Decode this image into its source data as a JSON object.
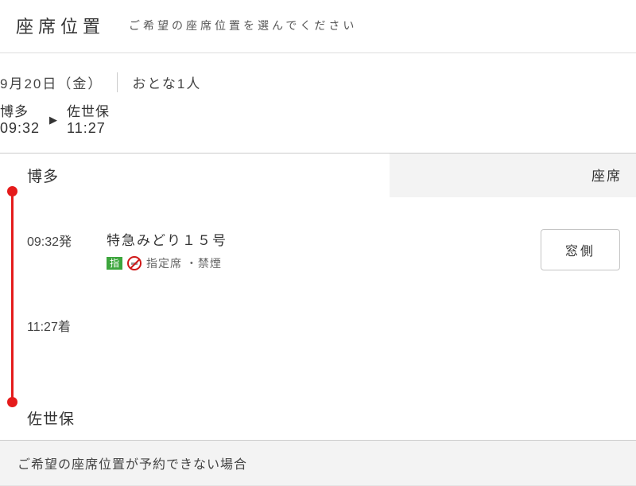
{
  "header": {
    "title": "座席位置",
    "subtitle": "ご希望の座席位置を選んでください"
  },
  "summary": {
    "date": "9月20日（金）",
    "pax": "おとな1人",
    "from_station": "博多",
    "from_time": "09:32",
    "to_station": "佐世保",
    "to_time": "11:27"
  },
  "segment": {
    "origin": "博多",
    "destination": "佐世保",
    "column_label": "座席",
    "depart_time": "09:32発",
    "arrive_time": "11:27着",
    "train_name": "特急みどり１５号",
    "reserve_tag": "指",
    "seat_type": "指定席 ・禁煙",
    "seat_button": "窓側"
  },
  "notice": {
    "text": "ご希望の座席位置が予約できない場合"
  }
}
